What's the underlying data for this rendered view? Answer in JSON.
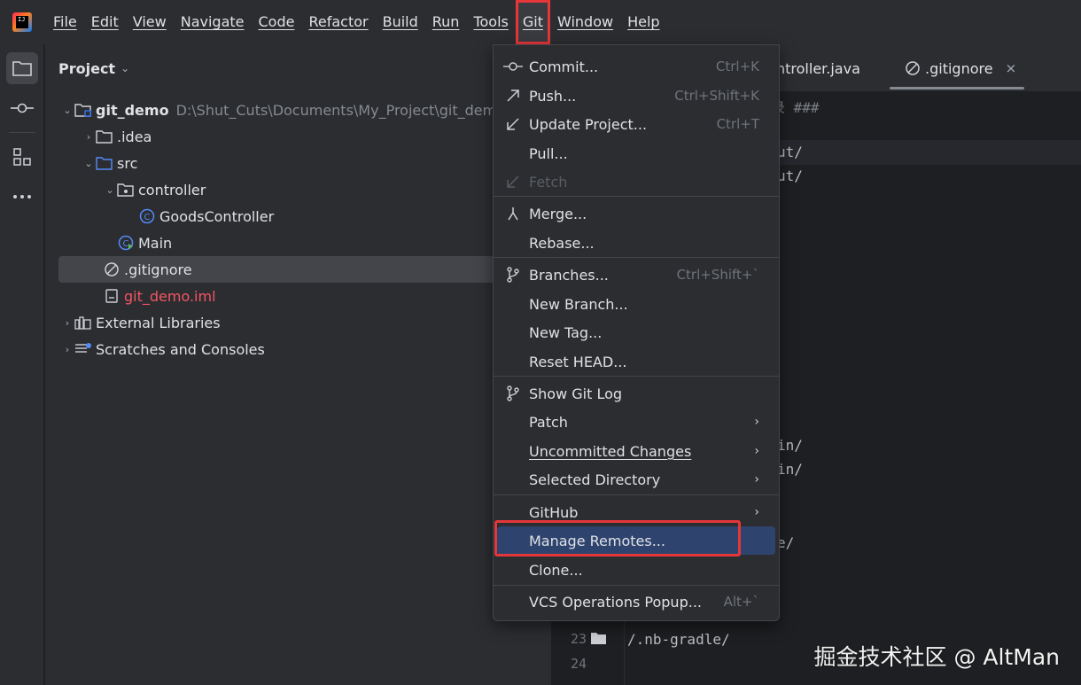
{
  "menubar": {
    "items": [
      "File",
      "Edit",
      "View",
      "Navigate",
      "Code",
      "Refactor",
      "Build",
      "Run",
      "Tools",
      "Git",
      "Window",
      "Help"
    ],
    "logo_text": "IJ"
  },
  "project": {
    "title": "Project",
    "root": {
      "name": "git_demo",
      "path": "D:\\Shut_Cuts\\Documents\\My_Project\\git_demo"
    },
    "nodes": [
      {
        "label": ".idea"
      },
      {
        "label": "src"
      },
      {
        "label": "controller"
      },
      {
        "label": "GoodsController"
      },
      {
        "label": "Main"
      },
      {
        "label": ".gitignore"
      },
      {
        "label": "git_demo.iml"
      },
      {
        "label": "External Libraries"
      },
      {
        "label": "Scratches and Consoles"
      }
    ]
  },
  "editor": {
    "tabs": [
      {
        "label": "ntroller.java"
      },
      {
        "label": ".gitignore",
        "close": "×"
      }
    ],
    "lines": [
      {
        "num": "",
        "text": "录 ###"
      },
      {
        "num": "",
        "text": "ut/"
      },
      {
        "num": "",
        "text": "ut/"
      },
      {
        "num": "",
        "text": "in/"
      },
      {
        "num": "",
        "text": "in/"
      },
      {
        "num": "",
        "text": "e/"
      },
      {
        "num": "23",
        "text": "/.nb-gradle/"
      },
      {
        "num": "24",
        "text": ""
      }
    ]
  },
  "git_menu": {
    "items": [
      {
        "label": "Commit...",
        "shortcut": "Ctrl+K",
        "icon": "commit-icon"
      },
      {
        "label": "Push...",
        "shortcut": "Ctrl+Shift+K",
        "icon": "push-icon"
      },
      {
        "label": "Update Project...",
        "shortcut": "Ctrl+T",
        "icon": "update-icon"
      },
      {
        "label": "Pull...",
        "shortcut": ""
      },
      {
        "label": "Fetch",
        "shortcut": "",
        "disabled": true,
        "icon": "fetch-icon"
      },
      {
        "label": "Merge...",
        "icon": "merge-icon"
      },
      {
        "label": "Rebase..."
      },
      {
        "label": "Branches...",
        "shortcut": "Ctrl+Shift+`",
        "icon": "branch-icon"
      },
      {
        "label": "New Branch..."
      },
      {
        "label": "New Tag..."
      },
      {
        "label": "Reset HEAD..."
      },
      {
        "label": "Show Git Log",
        "icon": "git-log-icon"
      },
      {
        "label": "Patch",
        "submenu": "›"
      },
      {
        "label": "Uncommitted Changes",
        "submenu": "›"
      },
      {
        "label": "Selected Directory",
        "submenu": "›"
      },
      {
        "label": "GitHub",
        "submenu": "›"
      },
      {
        "label": "Manage Remotes..."
      },
      {
        "label": "Clone..."
      },
      {
        "label": "VCS Operations Popup...",
        "shortcut": "Alt+`"
      }
    ]
  },
  "watermark": "掘金技术社区 @ AltMan",
  "colors": {
    "highlight": "#e5363a",
    "selection": "#2e436e",
    "accent": "#3574f0"
  }
}
